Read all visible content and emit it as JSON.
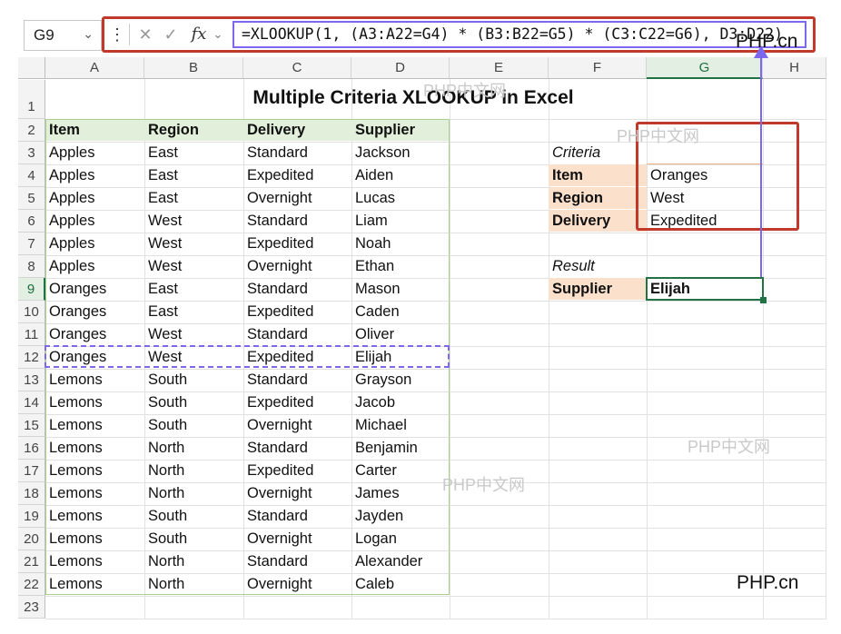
{
  "name_box": "G9",
  "formula_bar": {
    "menu_glyph": "⋮",
    "cancel_glyph": "✕",
    "enter_glyph": "✓",
    "fx_label": "fx",
    "formula": "=XLOOKUP(1, (A3:A22=G4) * (B3:B22=G5) * (C3:C22=G6), D3:D22)"
  },
  "columns": [
    "A",
    "B",
    "C",
    "D",
    "E",
    "F",
    "G",
    "H"
  ],
  "rows": [
    "1",
    "2",
    "3",
    "4",
    "5",
    "6",
    "7",
    "8",
    "9",
    "10",
    "11",
    "12",
    "13",
    "14",
    "15",
    "16",
    "17",
    "18",
    "19",
    "20",
    "21",
    "22",
    "23"
  ],
  "sheet_title": "Multiple Criteria XLOOKUP in Excel",
  "table": {
    "headers": [
      "Item",
      "Region",
      "Delivery",
      "Supplier"
    ],
    "rows": [
      [
        "Apples",
        "East",
        "Standard",
        "Jackson"
      ],
      [
        "Apples",
        "East",
        "Expedited",
        "Aiden"
      ],
      [
        "Apples",
        "East",
        "Overnight",
        "Lucas"
      ],
      [
        "Apples",
        "West",
        "Standard",
        "Liam"
      ],
      [
        "Apples",
        "West",
        "Expedited",
        "Noah"
      ],
      [
        "Apples",
        "West",
        "Overnight",
        "Ethan"
      ],
      [
        "Oranges",
        "East",
        "Standard",
        "Mason"
      ],
      [
        "Oranges",
        "East",
        "Expedited",
        "Caden"
      ],
      [
        "Oranges",
        "West",
        "Standard",
        "Oliver"
      ],
      [
        "Oranges",
        "West",
        "Expedited",
        "Elijah"
      ],
      [
        "Lemons",
        "South",
        "Standard",
        "Grayson"
      ],
      [
        "Lemons",
        "South",
        "Expedited",
        "Jacob"
      ],
      [
        "Lemons",
        "South",
        "Overnight",
        "Michael"
      ],
      [
        "Lemons",
        "North",
        "Standard",
        "Benjamin"
      ],
      [
        "Lemons",
        "North",
        "Expedited",
        "Carter"
      ],
      [
        "Lemons",
        "North",
        "Overnight",
        "James"
      ],
      [
        "Lemons",
        "South",
        "Standard",
        "Jayden"
      ],
      [
        "Lemons",
        "South",
        "Overnight",
        "Logan"
      ],
      [
        "Lemons",
        "North",
        "Standard",
        "Alexander"
      ],
      [
        "Lemons",
        "North",
        "Overnight",
        "Caleb"
      ]
    ]
  },
  "criteria": {
    "heading": "Criteria",
    "items": [
      {
        "label": "Item",
        "value": "Oranges"
      },
      {
        "label": "Region",
        "value": "West"
      },
      {
        "label": "Delivery",
        "value": "Expedited"
      }
    ]
  },
  "result": {
    "heading": "Result",
    "label": "Supplier",
    "value": "Elijah"
  },
  "watermarks": [
    "PHP中文网",
    "PHP中文网",
    "PHP中文网",
    "PHP中文网"
  ],
  "brand_marks": [
    "PHP.cn",
    "PHP.cn"
  ],
  "colors": {
    "header_fill": "#e2efda",
    "criteria_fill": "#fbe0cc",
    "annotation_red": "#c0392b",
    "annotation_purple": "#7b68ee",
    "selection_green": "#217346"
  }
}
